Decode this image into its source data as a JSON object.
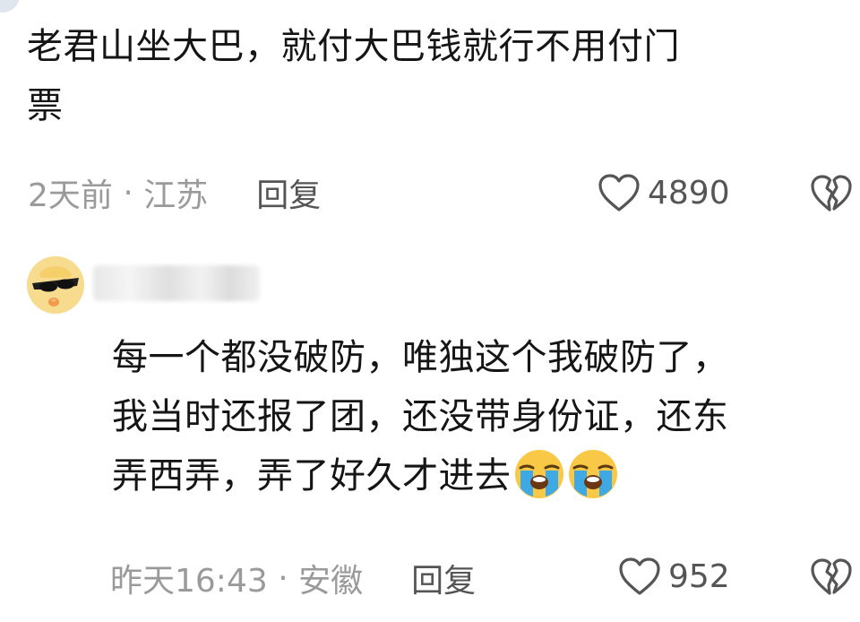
{
  "comment1": {
    "text_line1": "老君山坐大巴，就付大巴钱就行不用付门",
    "text_line2": "票",
    "time": "2天前",
    "sep": " · ",
    "location": "江苏",
    "reply_label": "回复",
    "likes": "4890"
  },
  "comment2": {
    "text_line1": "每一个都没破防，唯独这个我破防了，",
    "text_line2": "我当时还报了团，还没带身份证，还东",
    "text_line3": "弄西弄，弄了好久才进去",
    "time": "昨天16:43",
    "sep": " · ",
    "location": "安徽",
    "reply_label": "回复",
    "likes": "952",
    "emoji": [
      "loudly-crying-face",
      "loudly-crying-face"
    ]
  },
  "icons": {
    "like": "heart-icon",
    "dislike": "broken-heart-icon"
  },
  "colors": {
    "text": "#151515",
    "meta": "#9a9a9a",
    "action": "#555555",
    "background": "#ffffff"
  }
}
